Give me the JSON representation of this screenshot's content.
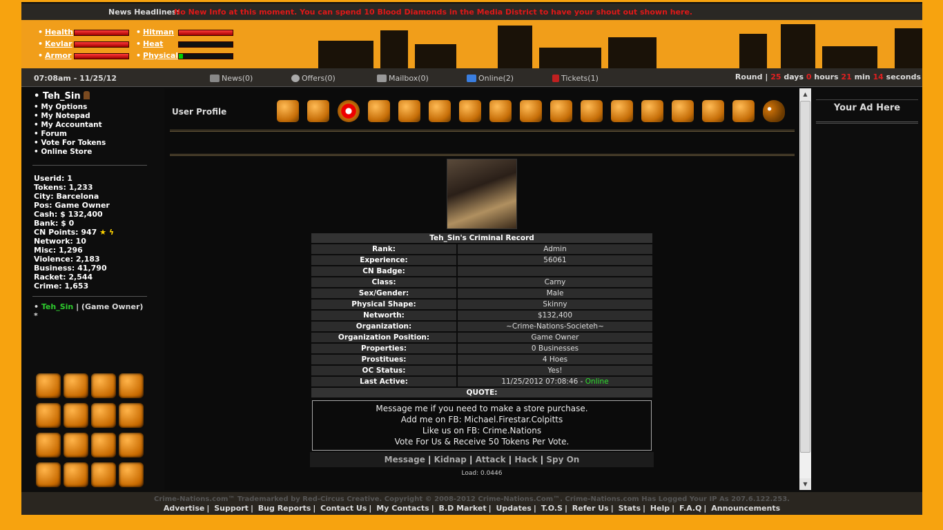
{
  "news": {
    "label": "News Headlines:",
    "text": "No New Info at this moment. You can spend 10 Blood Diamonds in the Media District to have your shout out shown here."
  },
  "stats_bars": [
    {
      "label": "Health",
      "level": 1.0
    },
    {
      "label": "Kevlar",
      "level": 1.0
    },
    {
      "label": "Armor",
      "level": 1.0
    },
    {
      "label": "Hitman",
      "level": 1.0
    },
    {
      "label": "Heat",
      "level": 0.0
    },
    {
      "label": "Physical",
      "level": 0.08
    }
  ],
  "status": {
    "time": "07:08am - 11/25/12",
    "news": "News(0)",
    "offers": "Offers(0)",
    "mailbox": "Mailbox(0)",
    "online": "Online(2)",
    "tickets": "Tickets(1)",
    "round_label": "Round",
    "days": "25",
    "days_lbl": "days",
    "hours": "0",
    "hours_lbl": "hours",
    "min": "21",
    "min_lbl": "min",
    "sec": "14",
    "sec_lbl": "seconds"
  },
  "sidebar": {
    "user": "Teh_Sin",
    "menu": [
      "My Options",
      "My Notepad",
      "My Accountant",
      "Forum",
      "Vote For Tokens",
      "Online Store"
    ],
    "stats": [
      "Userid: 1",
      "Tokens: 1,233",
      "City: Barcelona",
      "Pos: Game Owner",
      "Cash: $ 132,400",
      "Bank: $ 0",
      "CN Points: 947",
      "Network: 10",
      "Misc: 1,296",
      "Violence: 2,183",
      "Business: 41,790",
      "Racket: 2,544",
      "Crime: 1,653"
    ],
    "online_user": "Teh_Sin",
    "online_role": "| (Game Owner) *"
  },
  "main": {
    "title": "User Profile",
    "record_title": "Teh_Sin's Criminal Record",
    "rows": [
      {
        "k": "Rank:",
        "v": "Admin"
      },
      {
        "k": "Experience:",
        "v": "56061"
      },
      {
        "k": "CN Badge:",
        "v": ""
      },
      {
        "k": "Class:",
        "v": "Carny"
      },
      {
        "k": "Sex/Gender:",
        "v": "Male"
      },
      {
        "k": "Physical Shape:",
        "v": "Skinny"
      },
      {
        "k": "Networth:",
        "v": "$132,400"
      },
      {
        "k": "Organization:",
        "v": "~Crime-Nations-Societeh~"
      },
      {
        "k": "Organization Position:",
        "v": "Game Owner"
      },
      {
        "k": "Properties:",
        "v": "0 Businesses"
      },
      {
        "k": "Prostitues:",
        "v": "4 Hoes"
      }
    ],
    "oc_label": "OC Status:",
    "oc_value": "Yes!",
    "last_label": "Last Active:",
    "last_value": "11/25/2012 07:08:46 -",
    "last_online": "Online",
    "quote_label": "QUOTE:",
    "quote_lines": [
      "Message me if you need to make a store purchase.",
      "Add me on FB: Michael.Firestar.Colpitts",
      "Like us on FB: Crime.Nations",
      "Vote For Us & Receive 50 Tokens Per Vote."
    ],
    "actions": [
      "Message",
      "Kidnap",
      "Attack",
      "Hack",
      "Spy On"
    ],
    "load": "Load: 0.0446"
  },
  "ad": {
    "title": "Your Ad Here"
  },
  "footer": {
    "copy": "Crime-Nations.com™ Trademarked by Red-Circus Creative. Copyright © 2008-2012 Crime-Nations.Com™. Crime-Nations.com Has Logged Your IP As 207.6.122.253.",
    "links": [
      "Advertise",
      "Support",
      "Bug Reports",
      "Contact Us",
      "My Contacts",
      "B.D Market",
      "Updates",
      "T.O.S",
      "Refer Us",
      "Stats",
      "Help",
      "F.A.Q",
      "Announcements"
    ]
  }
}
